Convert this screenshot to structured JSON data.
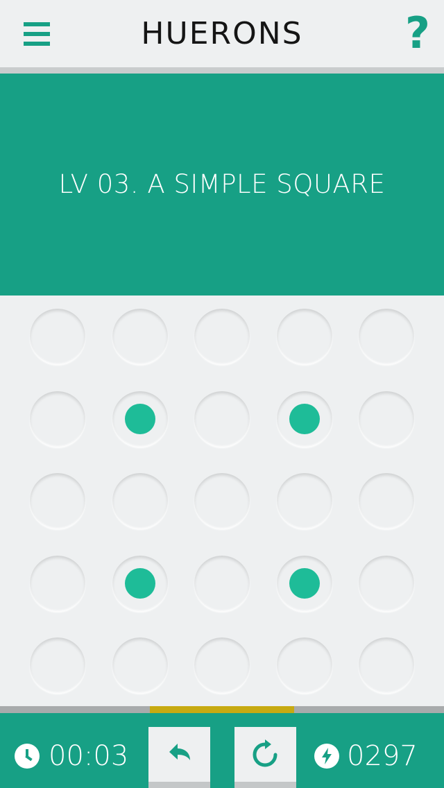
{
  "app": {
    "title": "HUERONS",
    "help_label": "?"
  },
  "level": {
    "title": "LV 03. A SIMPLE SQUARE"
  },
  "colors": {
    "accent": "#17a085",
    "dot": "#1ebc98",
    "progress": "#c7aa11",
    "background": "#eef0f1"
  },
  "board": {
    "rows": 5,
    "cols": 5,
    "filled": [
      [
        0,
        0,
        0,
        0,
        0
      ],
      [
        0,
        1,
        0,
        1,
        0
      ],
      [
        0,
        0,
        0,
        0,
        0
      ],
      [
        0,
        1,
        0,
        1,
        0
      ],
      [
        0,
        0,
        0,
        0,
        0
      ]
    ]
  },
  "progress": {
    "start_fraction": 0.338,
    "end_fraction": 0.662
  },
  "footer": {
    "timer": "00:03",
    "score": "0297",
    "icons": [
      "clock-icon",
      "undo-icon",
      "restart-icon",
      "bolt-icon"
    ]
  }
}
